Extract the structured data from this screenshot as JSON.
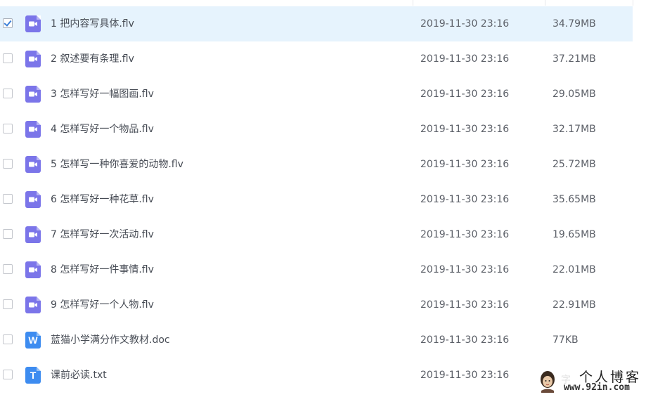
{
  "files": [
    {
      "name": "1 把内容写具体.flv",
      "date": "2019-11-30 23:16",
      "size": "34.79MB",
      "type": "video",
      "selected": true
    },
    {
      "name": "2 叙述要有条理.flv",
      "date": "2019-11-30 23:16",
      "size": "37.21MB",
      "type": "video",
      "selected": false
    },
    {
      "name": "3 怎样写好一幅图画.flv",
      "date": "2019-11-30 23:16",
      "size": "29.05MB",
      "type": "video",
      "selected": false
    },
    {
      "name": "4 怎样写好一个物品.flv",
      "date": "2019-11-30 23:16",
      "size": "32.17MB",
      "type": "video",
      "selected": false
    },
    {
      "name": "5 怎样写一种你喜爱的动物.flv",
      "date": "2019-11-30 23:16",
      "size": "25.72MB",
      "type": "video",
      "selected": false
    },
    {
      "name": "6 怎样写好一种花草.flv",
      "date": "2019-11-30 23:16",
      "size": "35.65MB",
      "type": "video",
      "selected": false
    },
    {
      "name": "7 怎样写好一次活动.flv",
      "date": "2019-11-30 23:16",
      "size": "19.65MB",
      "type": "video",
      "selected": false
    },
    {
      "name": "8 怎样写好一件事情.flv",
      "date": "2019-11-30 23:16",
      "size": "22.01MB",
      "type": "video",
      "selected": false
    },
    {
      "name": "9 怎样写好一个人物.flv",
      "date": "2019-11-30 23:16",
      "size": "22.91MB",
      "type": "video",
      "selected": false
    },
    {
      "name": "蓝猫小学满分作文教材.doc",
      "date": "2019-11-30 23:16",
      "size": "77KB",
      "type": "word",
      "selected": false
    },
    {
      "name": "课前必读.txt",
      "date": "2019-11-30 23:16",
      "size": "",
      "type": "text",
      "selected": false
    }
  ],
  "icon_glyphs": {
    "word": "W",
    "text": "T"
  },
  "icon_names": {
    "video": "video-file-icon",
    "word": "word-file-icon",
    "text": "text-file-icon"
  },
  "colors": {
    "selected_row": "#e6f3fd",
    "video_icon": "#7b75e9",
    "doc_icon": "#3d8cf0",
    "check": "#3b7fd8"
  },
  "watermark": {
    "title": "个人博客",
    "url": "www.92in.com"
  }
}
